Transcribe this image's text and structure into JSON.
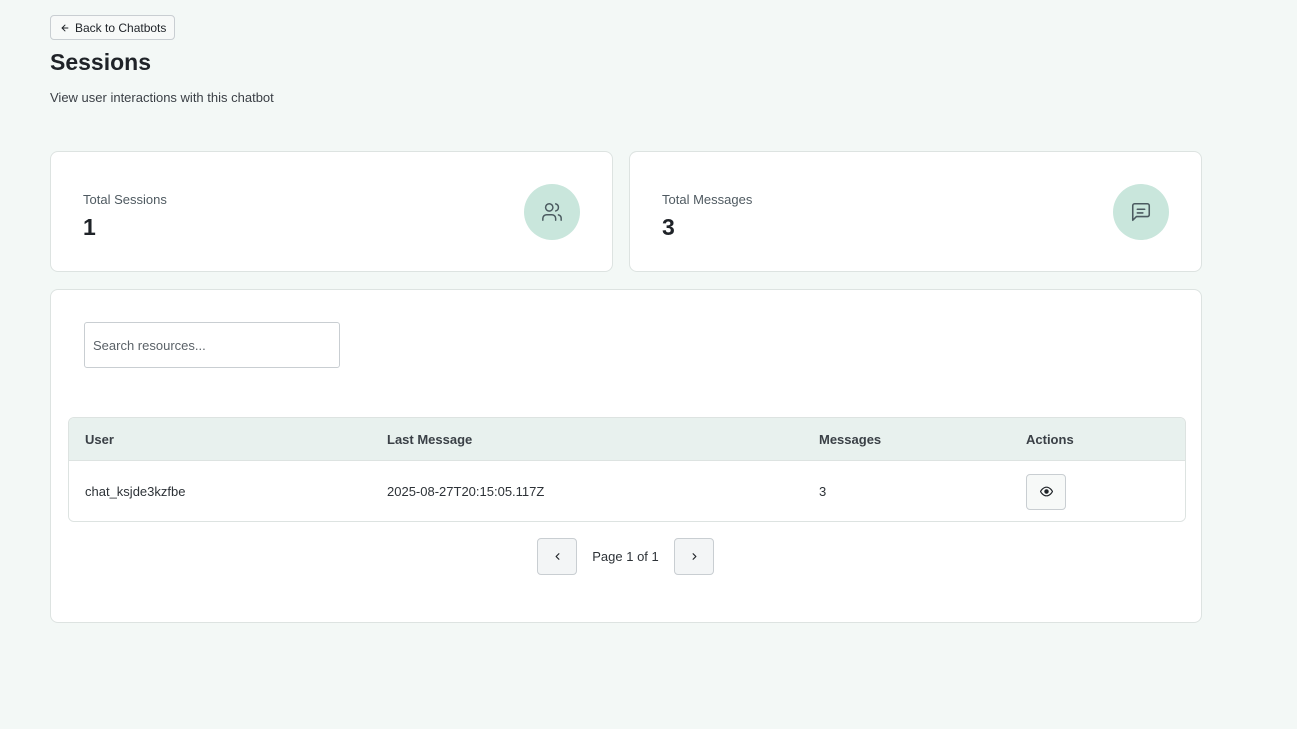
{
  "header": {
    "back_label": "Back to Chatbots",
    "title": "Sessions",
    "subtitle": "View user interactions with this chatbot"
  },
  "stats": {
    "sessions": {
      "label": "Total Sessions",
      "value": "1",
      "icon": "users-icon"
    },
    "messages": {
      "label": "Total Messages",
      "value": "3",
      "icon": "message-square-icon"
    }
  },
  "search": {
    "placeholder": "Search resources...",
    "value": ""
  },
  "table": {
    "columns": [
      "User",
      "Last Message",
      "Messages",
      "Actions"
    ],
    "rows": [
      {
        "user": "chat_ksjde3kzfbe",
        "last_message": "2025-08-27T20:15:05.117Z",
        "messages": "3",
        "action_icon": "eye-icon"
      }
    ]
  },
  "pagination": {
    "label": "Page 1 of 1",
    "current": 1,
    "total": 1
  },
  "colors": {
    "background": "#f3f8f6",
    "card": "#ffffff",
    "accent_soft": "#c9e6dc",
    "table_header": "#e8f1ee",
    "border": "#dde3e1"
  }
}
